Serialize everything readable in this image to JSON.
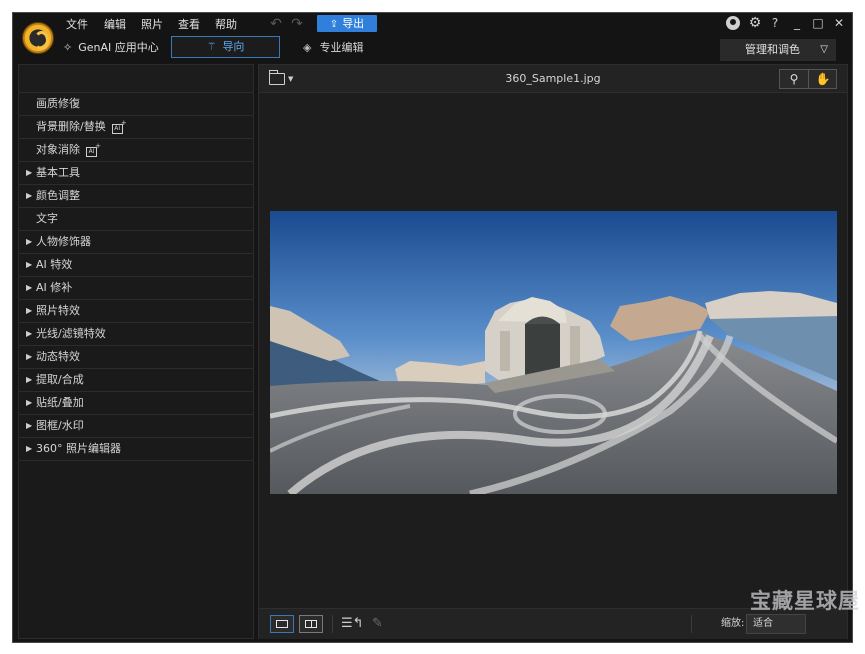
{
  "menu": [
    "文件",
    "编辑",
    "照片",
    "查看",
    "帮助"
  ],
  "toolbar": {
    "export_label": "导出"
  },
  "title_controls": {
    "help": "?",
    "minimize": "_",
    "maximize": "□",
    "close": "✕"
  },
  "modes": {
    "genai_label": "GenAI 应用中心",
    "guide_label": "导向",
    "pro_label": "专业编辑",
    "manage_label": "管理和调色"
  },
  "panel_items": [
    {
      "label": "画质修復",
      "expandable": false,
      "ai": false
    },
    {
      "label": "背景删除/替换",
      "expandable": false,
      "ai": true
    },
    {
      "label": "对象消除",
      "expandable": false,
      "ai": true
    },
    {
      "label": "基本工具",
      "expandable": true,
      "ai": false
    },
    {
      "label": "颜色调整",
      "expandable": true,
      "ai": false
    },
    {
      "label": "文字",
      "expandable": false,
      "ai": false
    },
    {
      "label": "人物修饰器",
      "expandable": true,
      "ai": false
    },
    {
      "label": "AI 特效",
      "expandable": true,
      "ai": false
    },
    {
      "label": "AI 修补",
      "expandable": true,
      "ai": false
    },
    {
      "label": "照片特效",
      "expandable": true,
      "ai": false
    },
    {
      "label": "光线/滤镜特效",
      "expandable": true,
      "ai": false
    },
    {
      "label": "动态特效",
      "expandable": true,
      "ai": false
    },
    {
      "label": "提取/合成",
      "expandable": true,
      "ai": false
    },
    {
      "label": "贴纸/叠加",
      "expandable": true,
      "ai": false
    },
    {
      "label": "图框/水印",
      "expandable": true,
      "ai": false
    },
    {
      "label": "360° 照片编辑器",
      "expandable": true,
      "ai": false
    }
  ],
  "viewer": {
    "file_name": "360_Sample1.jpg"
  },
  "bottom": {
    "zoom_label": "缩放:",
    "zoom_value": "适合"
  },
  "watermark": "宝藏星球屋",
  "colors": {
    "accent": "#2f7fdb",
    "guide_border": "#3a78b8"
  },
  "icons": {
    "folder": "folder-icon",
    "zoom": "magnifier-icon",
    "pan": "hand-icon",
    "export": "upload-icon",
    "settings": "gear-icon",
    "account": "user-icon"
  }
}
